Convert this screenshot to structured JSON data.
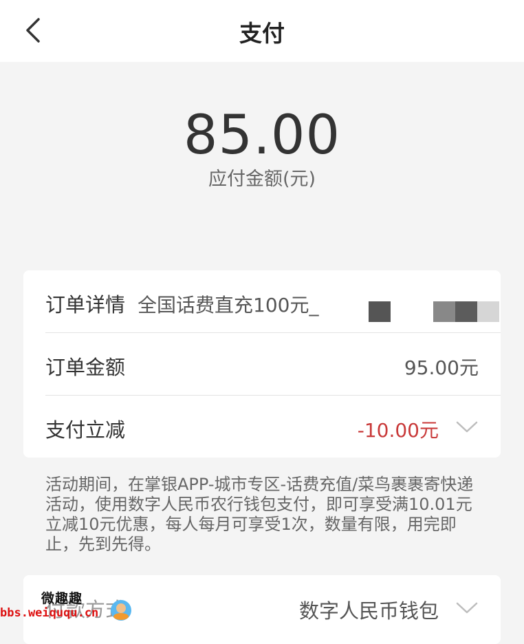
{
  "nav": {
    "title": "支付",
    "back_icon": "chevron-left-icon"
  },
  "payment": {
    "amount": "85.00",
    "amount_label": "应付金额(元)"
  },
  "order": {
    "detail_label": "订单详情",
    "detail_value": "全国话费直充100元_",
    "amount_label": "订单金额",
    "amount_value": "95.00元",
    "discount_label": "支付立减",
    "discount_value": "-10.00元"
  },
  "note": "活动期间，在掌银APP-城市专区-话费充值/菜鸟裹裹寄快递活动，使用数字人民币农行钱包支付，即可享受满10.01元立减10元优惠，每人每月可享受1次，数量有限，用完即止，先到先得。",
  "pay_method": {
    "label": "付款方式",
    "value": "数字人民币钱包"
  },
  "watermark": {
    "line1": "微趣趣",
    "line2": "bbs.weiququ.cn"
  },
  "colors": {
    "discount": "#c93a3a",
    "background": "#f4f4f4",
    "card": "#ffffff"
  }
}
